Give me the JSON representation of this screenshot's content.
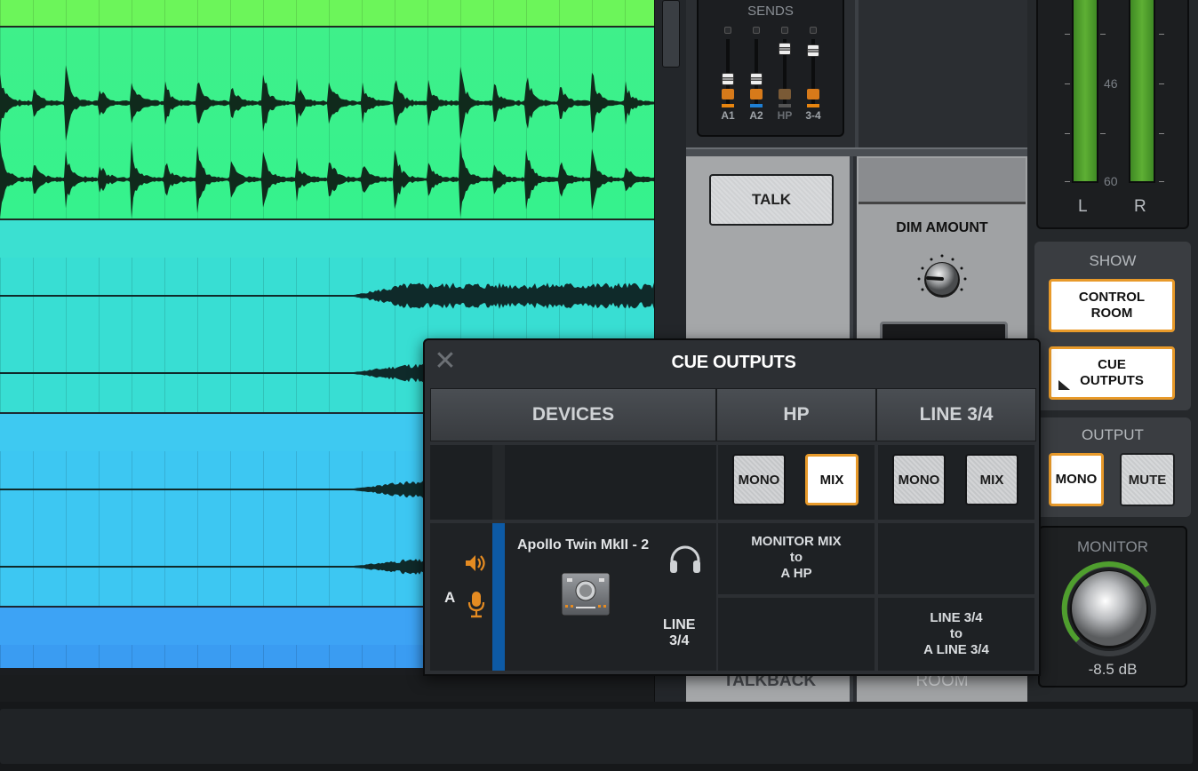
{
  "sends": {
    "title": "SENDS",
    "channels": [
      {
        "label": "A1",
        "color": "#d77a1a",
        "bar": "#e8850f"
      },
      {
        "label": "A2",
        "color": "#d77a1a",
        "bar": "#1e7fd4"
      },
      {
        "label": "HP",
        "color": "#7a5a36",
        "bar": "#555555"
      },
      {
        "label": "3-4",
        "color": "#d77a1a",
        "bar": "#e8850f"
      }
    ]
  },
  "talkback": {
    "talk_label": "TALK",
    "talkback_label": "TALKBACK"
  },
  "dim": {
    "title": "DIM AMOUNT",
    "room_label": "ROOM"
  },
  "meters": {
    "scale": [
      "46",
      "60"
    ],
    "left": "L",
    "right": "R"
  },
  "show": {
    "title": "SHOW",
    "control_room": "CONTROL ROOM",
    "cue_outputs": "CUE OUTPUTS"
  },
  "output": {
    "title": "OUTPUT",
    "mono": "MONO",
    "mute": "MUTE"
  },
  "monitor": {
    "title": "MONITOR",
    "value": "-8.5 dB"
  },
  "dialog": {
    "title": "CUE OUTPUTS",
    "close": "✕",
    "columns": {
      "devices": "DEVICES",
      "hp": "HP",
      "line": "LINE 3/4"
    },
    "hp_buttons": {
      "mono": "MONO",
      "mix": "MIX"
    },
    "line_buttons": {
      "mono": "MONO",
      "mix": "MIX"
    },
    "device": {
      "channel": "A",
      "name": "Apollo Twin MkII - 2",
      "line_label_1": "LINE",
      "line_label_2": "3/4"
    },
    "routes": {
      "hp_1": "MONITOR MIX",
      "hp_2": "to",
      "hp_3": "A HP",
      "line_1": "LINE 3/4",
      "line_2": "to",
      "line_3": "A LINE 3/4"
    }
  },
  "colors": {
    "accent": "#e89a2a",
    "meter_green": "#5eaf34",
    "device_blue": "#0d5aa5"
  }
}
